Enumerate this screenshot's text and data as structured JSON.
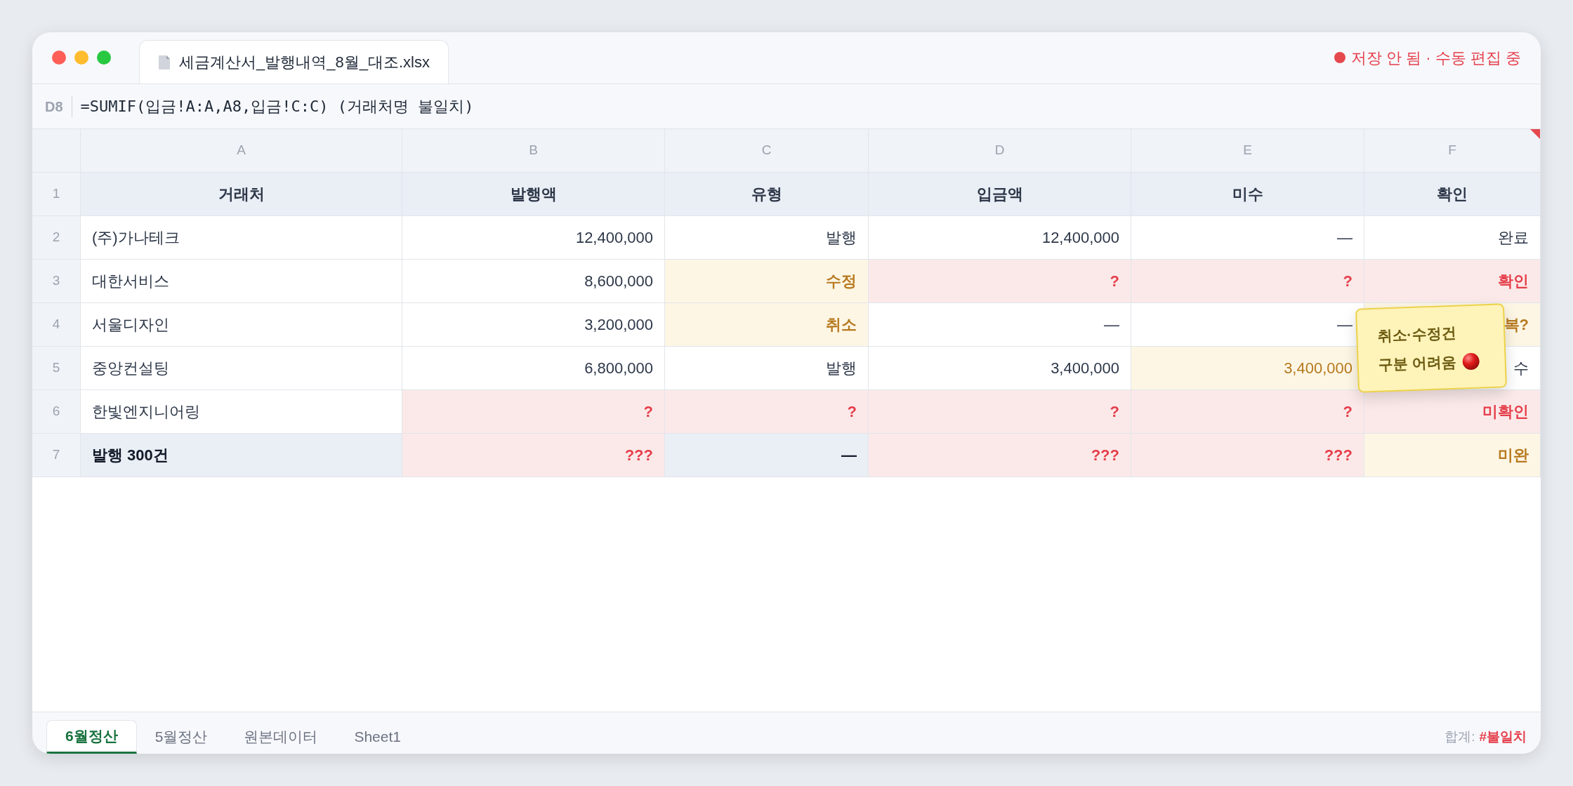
{
  "window": {
    "title": "세금계산서_발행내역_8월_대조.xlsx",
    "status": "저장 안 됨 · 수동 편집 중"
  },
  "formula_bar": {
    "cell_ref": "D8",
    "formula": "=SUMIF(입금!A:A,A8,입금!C:C) (거래처명 불일치)"
  },
  "sheet": {
    "column_letters": [
      "A",
      "B",
      "C",
      "D",
      "E",
      "F"
    ],
    "rows": [
      {
        "number": "1",
        "cells": [
          {
            "text": "거래처",
            "kind": "header"
          },
          {
            "text": "발행액",
            "kind": "header"
          },
          {
            "text": "유형",
            "kind": "header"
          },
          {
            "text": "입금액",
            "kind": "header"
          },
          {
            "text": "미수",
            "kind": "header"
          },
          {
            "text": "확인",
            "kind": "header"
          }
        ]
      },
      {
        "number": "2",
        "cells": [
          {
            "text": "(주)가나테크",
            "kind": "plain"
          },
          {
            "text": "12,400,000",
            "kind": "plain"
          },
          {
            "text": "발행",
            "kind": "plain"
          },
          {
            "text": "12,400,000",
            "kind": "plain"
          },
          {
            "text": "—",
            "kind": "plain"
          },
          {
            "text": "완료",
            "kind": "plain"
          }
        ]
      },
      {
        "number": "3",
        "cells": [
          {
            "text": "대한서비스",
            "kind": "plain"
          },
          {
            "text": "8,600,000",
            "kind": "plain"
          },
          {
            "text": "수정",
            "kind": "warn"
          },
          {
            "text": "?",
            "kind": "error"
          },
          {
            "text": "?",
            "kind": "error"
          },
          {
            "text": "확인",
            "kind": "error"
          }
        ]
      },
      {
        "number": "4",
        "cells": [
          {
            "text": "서울디자인",
            "kind": "plain"
          },
          {
            "text": "3,200,000",
            "kind": "plain"
          },
          {
            "text": "취소",
            "kind": "warn"
          },
          {
            "text": "—",
            "kind": "plain"
          },
          {
            "text": "—",
            "kind": "plain"
          },
          {
            "text": "복?",
            "kind": "warn"
          }
        ]
      },
      {
        "number": "5",
        "cells": [
          {
            "text": "중앙컨설팅",
            "kind": "plain"
          },
          {
            "text": "6,800,000",
            "kind": "plain"
          },
          {
            "text": "발행",
            "kind": "plain"
          },
          {
            "text": "3,400,000",
            "kind": "plain"
          },
          {
            "text": "3,400,000",
            "kind": "warn_light"
          },
          {
            "text": "수",
            "kind": "plain"
          }
        ]
      },
      {
        "number": "6",
        "cells": [
          {
            "text": "한빛엔지니어링",
            "kind": "plain"
          },
          {
            "text": "?",
            "kind": "error"
          },
          {
            "text": "?",
            "kind": "error"
          },
          {
            "text": "?",
            "kind": "error"
          },
          {
            "text": "?",
            "kind": "error"
          },
          {
            "text": "미확인",
            "kind": "error"
          }
        ]
      },
      {
        "number": "7",
        "cells": [
          {
            "text": "발행 300건",
            "kind": "total"
          },
          {
            "text": "???",
            "kind": "error"
          },
          {
            "text": "—",
            "kind": "total"
          },
          {
            "text": "???",
            "kind": "error"
          },
          {
            "text": "???",
            "kind": "error"
          },
          {
            "text": "미완",
            "kind": "warn"
          }
        ]
      }
    ],
    "note": {
      "lines": [
        "취소·수정건",
        "구분 어려움"
      ]
    }
  },
  "sheet_tabs": [
    {
      "label": "6월정산",
      "selected": true
    },
    {
      "label": "5월정산",
      "selected": false
    },
    {
      "label": "원본데이터",
      "selected": false
    },
    {
      "label": "Sheet1",
      "selected": false
    }
  ],
  "status_bar": {
    "label": "합계:",
    "value": "#불일치"
  }
}
